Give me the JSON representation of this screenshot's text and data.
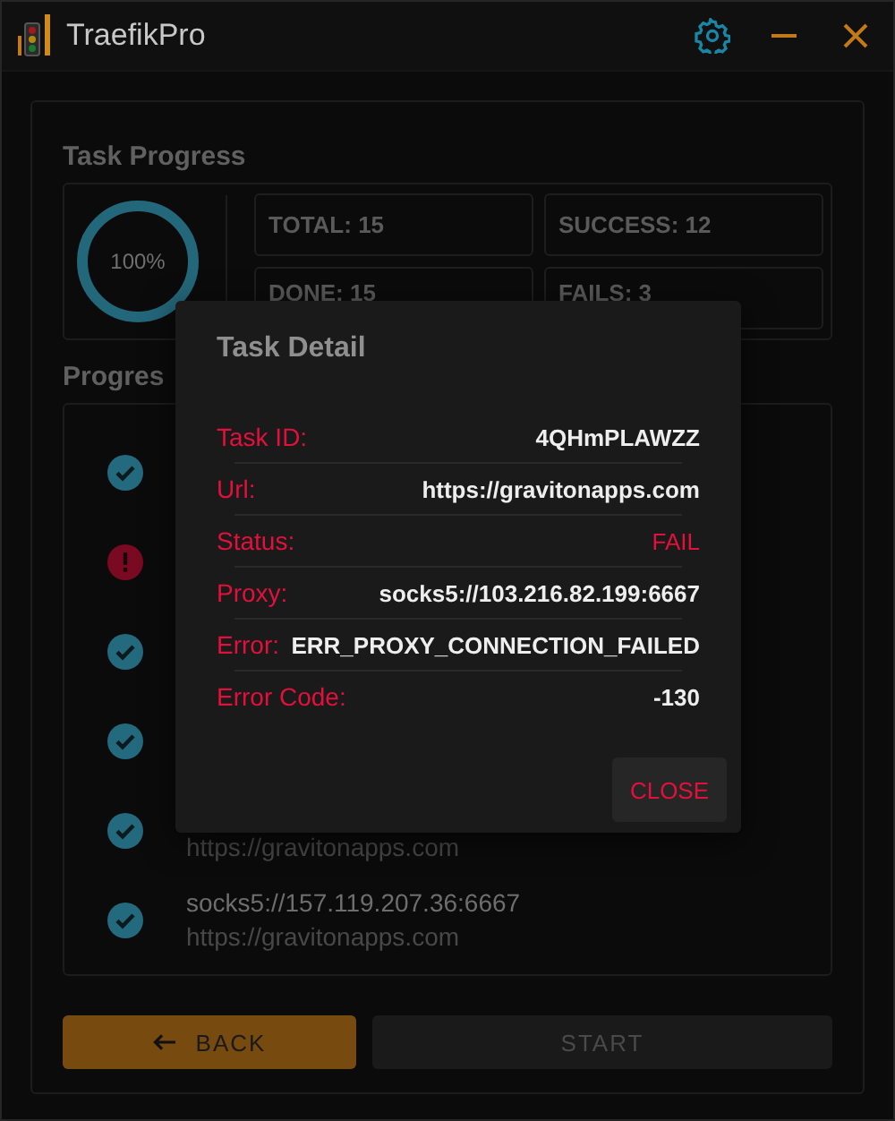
{
  "window": {
    "title": "TraefikPro"
  },
  "task_progress": {
    "title": "Task Progress",
    "progress": {
      "level": 1,
      "label": "100%"
    },
    "stats": [
      "TOTAL: 15",
      "SUCCESS: 12",
      "DONE: 15",
      "FAILS: 3"
    ]
  },
  "progress_list": {
    "title": "Progres",
    "items": [
      {
        "kind": "success"
      },
      {
        "kind": "fail"
      },
      {
        "kind": "success"
      },
      {
        "kind": "success"
      },
      {
        "kind": "success",
        "url": "https://gravitonapps.com"
      },
      {
        "kind": "success",
        "proxy": "socks5://157.119.207.36:6667",
        "url": "https://gravitonapps.com"
      }
    ]
  },
  "buttons": [
    {
      "kind": "back",
      "label": "BACK",
      "disabled": false
    },
    {
      "kind": "plain",
      "label": "START",
      "disabled": true
    }
  ],
  "dialog": {
    "title": "Task Detail",
    "fields": [
      {
        "kind": "text",
        "label": "Task ID:",
        "value": "4QHmPLAWZZ"
      },
      {
        "kind": "text",
        "label": "Url:",
        "value": "https://gravitonapps.com"
      },
      {
        "kind": "status",
        "label": "Status:",
        "value": "FAIL"
      },
      {
        "kind": "text",
        "label": "Proxy:",
        "value": "socks5://103.216.82.199:6667"
      },
      {
        "kind": "text",
        "label": "Error:",
        "value": "ERR_PROXY_CONNECTION_FAILED"
      },
      {
        "kind": "text",
        "label": "Error Code:",
        "value": "-130"
      }
    ],
    "close": "CLOSE"
  }
}
